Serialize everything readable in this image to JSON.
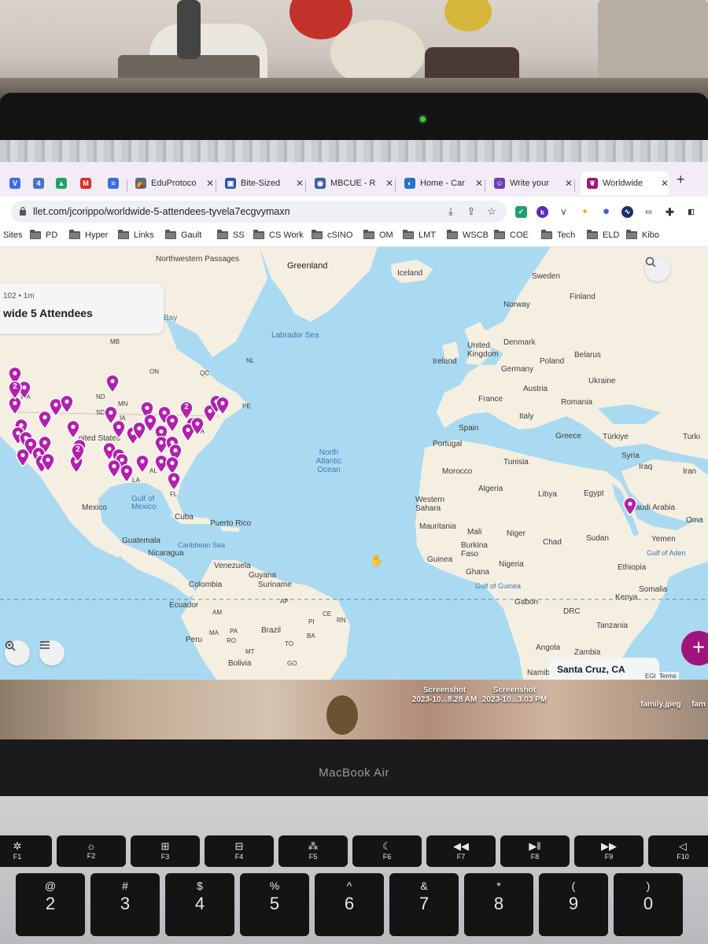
{
  "browser": {
    "tabs": [
      {
        "label": "",
        "fav": "V",
        "color": "#3b6ee0"
      },
      {
        "label": "",
        "fav": "4",
        "color": "#4a72c9"
      },
      {
        "label": "",
        "fav": "▲",
        "color": "#1fa463"
      },
      {
        "label": "",
        "fav": "M",
        "color": "#d93025"
      },
      {
        "label": "",
        "fav": "≡",
        "color": "#3b6ee0"
      },
      {
        "label": "EduProtoco",
        "fav": "⛺",
        "color": "#5a6b7a"
      },
      {
        "label": "Bite-Sized",
        "fav": "▣",
        "color": "#2a56b8"
      },
      {
        "label": "MBCUE - R",
        "fav": "◉",
        "color": "#3c5fae"
      },
      {
        "label": "Home - Car",
        "fav": "◐",
        "color": "#2a73c9"
      },
      {
        "label": "Write your",
        "fav": "☺",
        "color": "#6b3fb8"
      },
      {
        "label": "Worldwide",
        "fav": "❦",
        "color": "#a0147d"
      }
    ],
    "url": "llet.com/jcorippo/worldwide-5-attendees-tyvela7ecgvymaxn",
    "bookmarks": [
      "Sites",
      "PD",
      "Hyper",
      "Links",
      "Gault",
      "SS",
      "CS Work",
      "cSINO",
      "OM",
      "LMT",
      "WSCB",
      "COE",
      "Tech",
      "ELD",
      "Kibo"
    ]
  },
  "card": {
    "meta": "102 • 1m",
    "title": "wide 5 Attendees"
  },
  "map": {
    "pin_color": "#b31fae",
    "labels": {
      "greenland": "Greenland",
      "iceland": "Iceland",
      "sweden": "Sweden",
      "finland": "Finland",
      "norway": "Norway",
      "nw_passages": "Northwestern Passages",
      "bay": "Bay",
      "labrador": "Labrador Sea",
      "denmark": "Denmark",
      "belarus": "Belarus",
      "ireland": "Ireland",
      "uk": "United Kingdom",
      "poland": "Poland",
      "germany": "Germany",
      "ukraine": "Ukraine",
      "austria": "Austria",
      "france": "France",
      "romania": "Romania",
      "italy": "Italy",
      "spain": "Spain",
      "greece": "Greece",
      "turkiye": "Türkiye",
      "turk": "Turkı",
      "portugal": "Portugal",
      "syria": "Syria",
      "iraq": "Iraq",
      "iran": "Iran",
      "tunisia": "Tunisia",
      "morocco": "Morocco",
      "algeria": "Algeria",
      "libya": "Libya",
      "egypt": "Egypt",
      "saudi": "audi Arabia",
      "oma": "Oma",
      "western_sahara": "Western Sahara",
      "mauritania": "Mauritania",
      "mali": "Mali",
      "niger": "Niger",
      "chad": "Chad",
      "sudan": "Sudan",
      "yemen": "Yemen",
      "gulf_aden": "Gulf of Aden",
      "burkina": "Burkina Faso",
      "nigeria": "Nigeria",
      "ethiopia": "Ethiopia",
      "guinea": "Guinea",
      "ghana": "Ghana",
      "somalia": "Somalia",
      "gulf_guinea": "Gulf of Guinea",
      "gabon": "Gabon",
      "kenya": "Kenya",
      "drc": "DRC",
      "tanzania": "Tanzania",
      "angola": "Angola",
      "zambia": "Zambia",
      "namib": "Namib",
      "north_atlantic": "North Atlantic Ocean",
      "mexico": "Mexico",
      "gulf_mexico": "Gulf of Mexico",
      "cuba": "Cuba",
      "puerto_rico": "Puerto Rico",
      "guatemala": "Guatemala",
      "caribbean": "Caribbean Sea",
      "nicaragua": "Nicaragua",
      "venezuela": "Venezuela",
      "guyana": "Guyana",
      "suriname": "Suriname",
      "colombia": "Colombia",
      "ecuador": "Ecuador",
      "brazil": "Brazil",
      "peru": "Peru",
      "bolivia": "Bolivia",
      "united_states": "nited States",
      "st_mb": "MB",
      "st_on": "ON",
      "st_qc": "QC",
      "st_nl": "NL",
      "st_nd": "ND",
      "st_mn": "MN",
      "st_sd": "SD",
      "st_ia": "IA",
      "st_wa": "WA",
      "st_ny": "NY",
      "st_pe": "PE",
      "st_va": "VA",
      "st_al": "AL",
      "st_la": "LA",
      "st_fl": "FL",
      "st_ma": "MA",
      "st_pa": "PA",
      "st_ba": "BA",
      "st_mt": "MT",
      "st_to": "TO",
      "st_pi": "PI",
      "st_ce": "CE",
      "st_rn": "RN",
      "st_am": "AM",
      "st_ro": "RO",
      "st_ap": "AP",
      "st_go": "GO"
    }
  },
  "pins_counts": {
    "a": "2",
    "b": "2",
    "c": "2"
  },
  "location_chip": "Santa Cruz, CA",
  "terms": "Terms",
  "egi": "EGI",
  "desktop": {
    "file1": "Screenshot\n2023-10...8.28 AM",
    "file2": "Screenshot\n2023-10...3.03 PM",
    "file3": "family.jpeg",
    "file4": "fam"
  },
  "device": {
    "brand": "MacBook Air"
  },
  "keys": {
    "f1": "F1",
    "f2": "F2",
    "f3": "F3",
    "f4": "F4",
    "f5": "F5",
    "f6": "F6",
    "f7": "F7",
    "f8": "F8",
    "f9": "F9",
    "f10": "F10",
    "k2": "2",
    "k3": "3",
    "k4": "4",
    "k5": "5",
    "k6": "6",
    "k7": "7",
    "k8": "8",
    "k9": "9",
    "k0": "0",
    "s2": "@",
    "s3": "#",
    "s4": "$",
    "s5": "%",
    "s6": "^",
    "s7": "&",
    "s8": "*",
    "s9": "(",
    "s0": ")"
  }
}
